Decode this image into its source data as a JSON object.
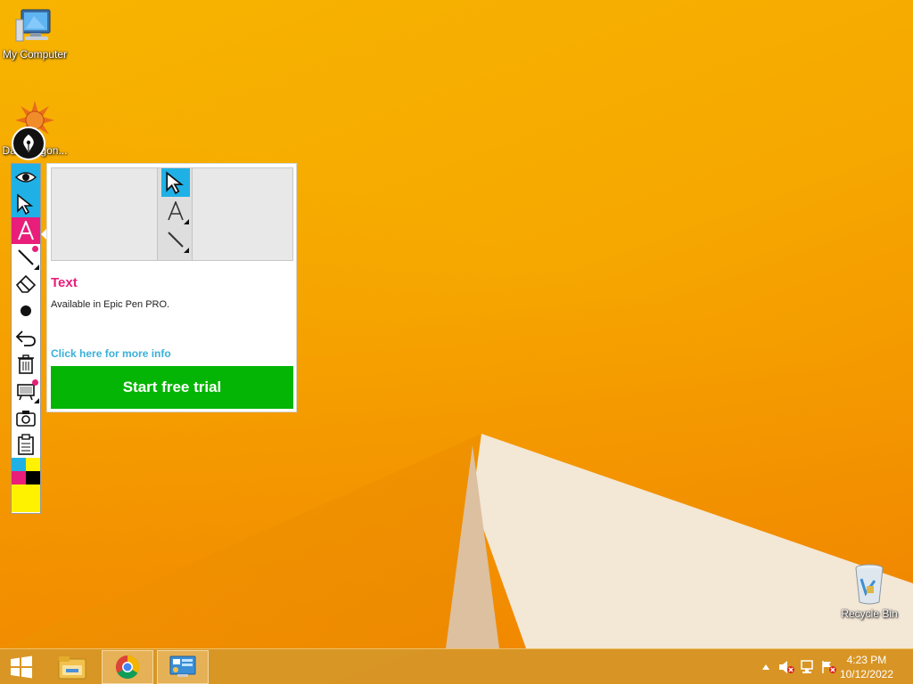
{
  "desktop": {
    "icons": [
      {
        "label": "My Computer"
      },
      {
        "label": "Dad Wagon..."
      },
      {
        "label": "Recycle Bin"
      }
    ]
  },
  "epic_pen": {
    "tools": [
      "eye-icon",
      "cursor-icon",
      "text-icon",
      "line-icon",
      "eraser-icon",
      "brush-icon",
      "undo-icon",
      "trash-icon",
      "whiteboard-icon",
      "camera-icon",
      "clipboard-icon"
    ],
    "colors": {
      "blue": "#1fb1e6",
      "pink": "#e81e7a",
      "yellow": "#fff200",
      "black": "#000000"
    },
    "popup": {
      "title": "Text",
      "description": "Available in Epic Pen PRO.",
      "link": "Click here for more info",
      "button": "Start free trial"
    }
  },
  "taskbar": {
    "apps": [
      "start-button",
      "file-explorer",
      "chrome",
      "control-panel"
    ],
    "clock": {
      "time": "4:23 PM",
      "date": "10/12/2022"
    }
  }
}
